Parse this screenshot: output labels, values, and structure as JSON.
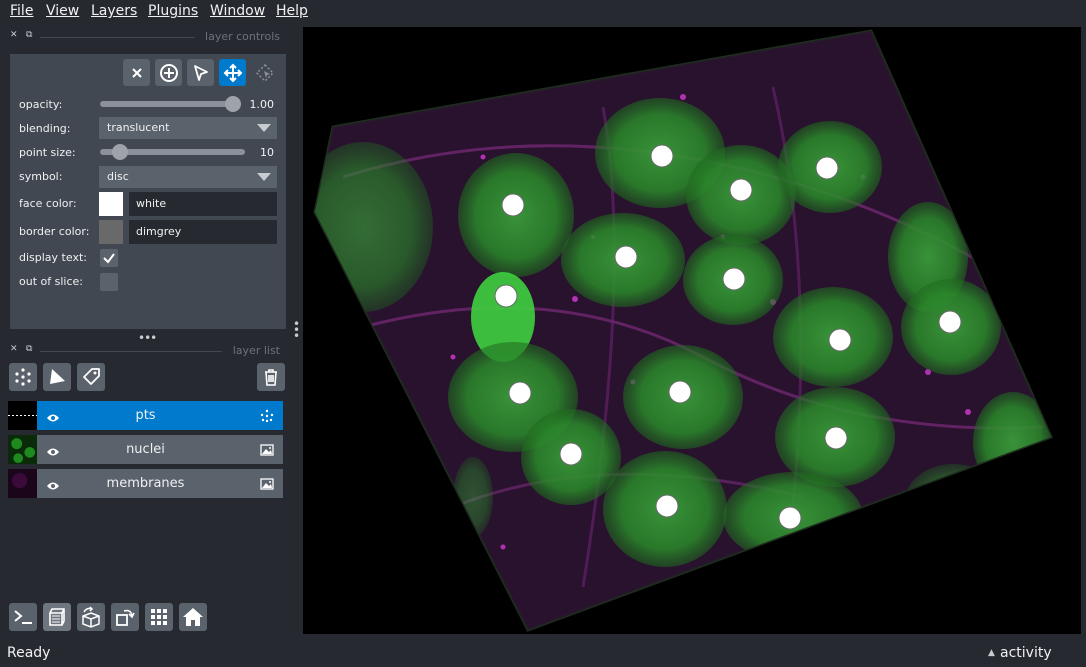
{
  "menu": [
    "File",
    "View",
    "Layers",
    "Plugins",
    "Window",
    "Help"
  ],
  "layer_controls": {
    "title": "layer controls",
    "opacity": {
      "label": "opacity:",
      "value": "1.00",
      "fraction": 1.0
    },
    "blending": {
      "label": "blending:",
      "value": "translucent"
    },
    "point_size": {
      "label": "point size:",
      "value": "10",
      "fraction": 0.1
    },
    "symbol": {
      "label": "symbol:",
      "value": "disc"
    },
    "face_color": {
      "label": "face color:",
      "value": "white",
      "swatch": "#ffffff"
    },
    "border_color": {
      "label": "border color:",
      "value": "dimgrey",
      "swatch": "#696969"
    },
    "display_text": {
      "label": "display text:",
      "checked": true
    },
    "out_of_slice": {
      "label": "out of slice:",
      "checked": false
    }
  },
  "layer_list": {
    "title": "layer list",
    "layers": [
      {
        "name": "pts",
        "type": "points",
        "selected": true,
        "visible": true
      },
      {
        "name": "nuclei",
        "type": "image",
        "selected": false,
        "visible": true
      },
      {
        "name": "membranes",
        "type": "image",
        "selected": false,
        "visible": true
      }
    ]
  },
  "status": {
    "text": "Ready",
    "activity": "activity"
  },
  "colors": {
    "accent": "#007acc",
    "nuclei": "#2fd62f",
    "membranes": "#c21fc2",
    "points": "#ffffff"
  },
  "icons": {
    "toolbar": [
      "close-icon",
      "add-points-icon",
      "select-points-icon",
      "pan-zoom-icon",
      "transform-icon"
    ],
    "layer_buttons": [
      "new-points-icon",
      "new-shapes-icon",
      "new-labels-icon",
      "delete-icon"
    ],
    "bottom": [
      "console-icon",
      "ndisplay-icon",
      "roll-icon",
      "transpose-icon",
      "grid-icon",
      "home-icon"
    ]
  }
}
